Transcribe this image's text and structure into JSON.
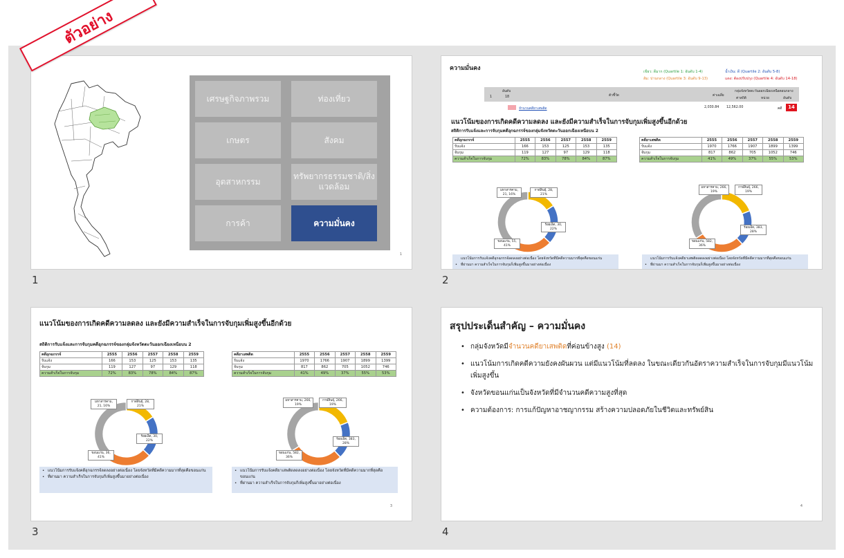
{
  "ribbon": "ตัวอย่าง",
  "slides": [
    {
      "number": "1",
      "page_no": "1",
      "menu": [
        "เศรษฐกิจภาพรวม",
        "ท่องเที่ยว",
        "เกษตร",
        "สังคม",
        "อุตสาหกรรม",
        "ทรัพยากรธรรมชาติ/สิ่งแวดล้อม",
        "การค้า",
        "ความมั่นคง"
      ],
      "active": "ความมั่นคง"
    },
    {
      "number": "2",
      "title": "ความมั่นคง",
      "legend": {
        "green": "เขียว: ดีมาก (Quartile 1: อันดับ 1-4)",
        "blue": "น้ำเงิน: ดี (Quartile 2: อันดับ 5-8)",
        "orange": "ส้ม: ปานกลาง (Quartile 3: อันดับ 9-13)",
        "red": "แดง: ต้องปรับปรุง (Quartile 4: อันดับ 14-18)"
      },
      "rank_table": {
        "h_rank": "อันดับ",
        "h_rank_vals": [
          "1",
          "18"
        ],
        "h_indicator": "ตัวชี้วัด",
        "h_avg": "ค่าเฉลี่ย",
        "h_group": "กลุ่มจังหวัดตะวันออกเฉียงเหนือตอนกลาง",
        "h_val": "ค่าสถิติ",
        "h_unit": "หน่วย",
        "h_ord": "อันดับ",
        "row": {
          "indicator": "จำนวนคดียาเสพติด",
          "avg": "2,030.84",
          "val": "12,562.00",
          "unit": "คดี",
          "rank": "14"
        }
      },
      "headline": "แนวโน้มของการเกิดคดีความลดลง และยังมีความสำเร็จในการจับกุมเพิ่มสูงขึ้นอีกด้วย",
      "subhead": "สถิติการรับแจ้งและการจับกุมคดีอุกฉกรรจ์ของกลุ่มจังหวัดตะวันออกเฉียงเหนือบน 2"
    },
    {
      "number": "3",
      "page_no": "3",
      "headline": "แนวโน้มของการเกิดคดีความลดลง และยังมีความสำเร็จในการจับกุมเพิ่มสูงขึ้นอีกด้วย",
      "subhead": "สถิติการรับแจ้งและการจับกุมคดีอุกฉกรรจ์ของกลุ่มจังหวัดตะวันออกเฉียงเหนือบน 2"
    },
    {
      "number": "4",
      "page_no": "4",
      "title": "สรุปประเด็นสำคัญ – ความมั่นคง",
      "bullets": [
        {
          "pre": "กลุ่มจังหวัดมี",
          "hl": "จำนวนคดียาเสพติด",
          "post": "ที่ค่อนข้างสูง ",
          "rank": "(14)"
        },
        {
          "text": "แนวโน้มการเกิดคดีความยังคงผันผวน แต่มีแนวโน้มที่ลดลง ในขณะเดียวกันอัตราความสำเร็จในการจับกุมมีแนวโน้มเพิ่มสูงขึ้น"
        },
        {
          "text": "จังหวัดขอนแก่นเป็นจังหวัดที่มีจำนวนคดีความสูงที่สุด"
        },
        {
          "text": "ความต้องการ: การแก้ปัญหาอาชญากรรม สร้างความปลอดภัยในชีวิตและทรัพย์สิน"
        }
      ]
    }
  ],
  "tables": {
    "violent": {
      "header": [
        "คดีอุกฉกรรจ์",
        "2555",
        "2556",
        "2557",
        "2558",
        "2559"
      ],
      "rows": [
        [
          "รับแจ้ง",
          "166",
          "153",
          "125",
          "153",
          "135"
        ],
        [
          "จับกุม",
          "119",
          "127",
          "97",
          "129",
          "118"
        ]
      ],
      "success": [
        "ความสำเร็จในการจับกุม",
        "72%",
        "83%",
        "78%",
        "84%",
        "87%"
      ],
      "labels": [
        "มหาสารคาม, 21, 16%",
        "กาฬสินธุ์, 28, 21%",
        "ร้อยเอ็ด, 30, 22%",
        "ขอนแก่น, 55, 41%"
      ],
      "labels_s3": [
        "มหาสารคาม, 21, 16%",
        "กาฬสินธุ์, 28, 21%",
        "ร้อยเอ็ด, 30, 22%",
        "ขอนแก่น, 36, 41%"
      ],
      "notes": [
        "แนวโน้มการรับแจ้งคดีอุกฉกรรจ์ลดลงอย่างต่อเนื่อง โดยจังหวัดที่มีคดีความมากที่สุดคือขอนแก่น",
        "ที่ผ่านมา ความสำเร็จในการจับกุมก็เพิ่มสูงขึ้นมาอย่างต่อเนื่อง"
      ]
    },
    "drug": {
      "header": [
        "คดียาเสพติด",
        "2555",
        "2556",
        "2557",
        "2558",
        "2559"
      ],
      "header_s3": [
        "คดียาเสพติด",
        "2555",
        "2556",
        "2557",
        "2558",
        "2559"
      ],
      "rows": [
        [
          "รับแจ้ง",
          "1970",
          "1766",
          "1907",
          "1899",
          "1399"
        ],
        [
          "จับกุม",
          "817",
          "862",
          "705",
          "1052",
          "746"
        ]
      ],
      "success": [
        "ความสำเร็จในการจับกุม",
        "41%",
        "49%",
        "37%",
        "55%",
        "53%"
      ],
      "labels": [
        "มหาสารคาม, 266, 19%",
        "กาฬสินธุ์, 266, 19%",
        "ร้อยเอ็ด, 383, 28%",
        "ขอนแก่น, 582, 36%"
      ],
      "notes": [
        "แนวโน้มการรับแจ้งคดียาเสพติดลดลงอย่างต่อเนื่อง โดยจังหวัดที่มีคดีความมากที่สุดคือขอนแก่น",
        "ที่ผ่านมา ความสำเร็จในการจับกุมก็เพิ่มสูงขึ้นมาอย่างต่อเนื่อง"
      ]
    }
  },
  "donut_violent": [
    {
      "name": "มหาสารคาม",
      "pct": 16,
      "color": "#f2b800"
    },
    {
      "name": "กาฬสินธุ์",
      "pct": 21,
      "color": "#4472c4"
    },
    {
      "name": "ร้อยเอ็ด",
      "pct": 22,
      "color": "#ed7d31"
    },
    {
      "name": "ขอนแก่น",
      "pct": 41,
      "color": "#a5a5a5"
    }
  ],
  "donut_drug": [
    {
      "name": "มหาสารคาม",
      "pct": 19,
      "color": "#f2b800"
    },
    {
      "name": "กาฬสินธุ์",
      "pct": 19,
      "color": "#4472c4"
    },
    {
      "name": "ร้อยเอ็ด",
      "pct": 28,
      "color": "#ed7d31"
    },
    {
      "name": "ขอนแก่น",
      "pct": 34,
      "color": "#a5a5a5"
    }
  ]
}
